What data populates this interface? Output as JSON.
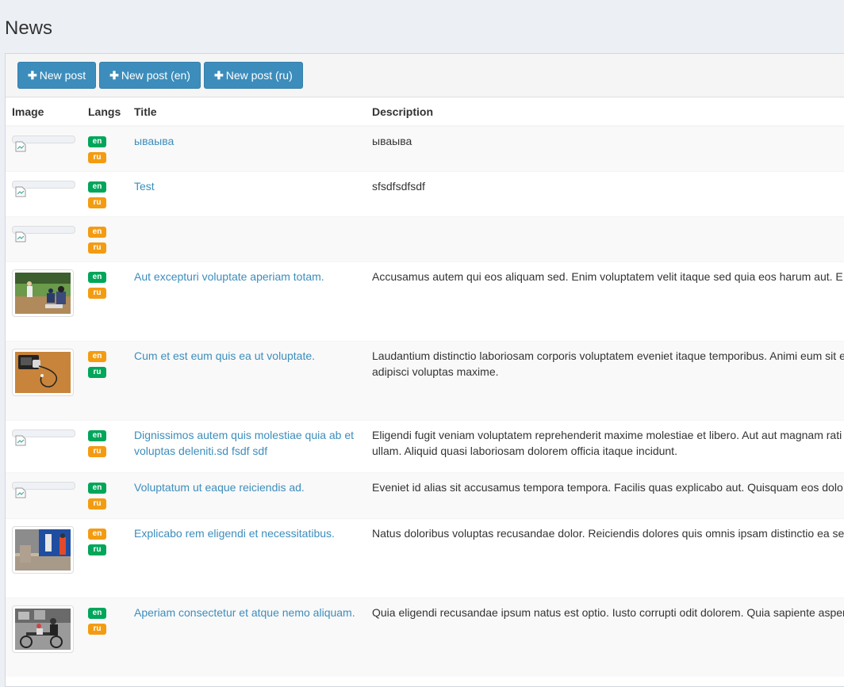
{
  "page_title": "News",
  "toolbar": {
    "buttons": [
      {
        "label": "New post",
        "icon": "plus-icon"
      },
      {
        "label": "New post (en)",
        "icon": "plus-icon"
      },
      {
        "label": "New post (ru)",
        "icon": "plus-icon"
      }
    ]
  },
  "table": {
    "headers": {
      "image": "Image",
      "langs": "Langs",
      "title": "Title",
      "description": "Description"
    },
    "rows": [
      {
        "image": "broken",
        "langs": [
          "en",
          "ru"
        ],
        "title": "ываыва",
        "description": "ываыва"
      },
      {
        "image": "broken",
        "langs": [
          "en",
          "ru"
        ],
        "title": "Test",
        "description": "sfsdfsdfsdf"
      },
      {
        "image": "broken",
        "langs": [
          "en",
          "ru"
        ],
        "title": "",
        "description": ""
      },
      {
        "image": "baseball",
        "langs": [
          "en",
          "ru"
        ],
        "title": "Aut excepturi voluptate aperiam totam.",
        "description": "Accusamus autem qui eos aliquam sed. Enim voluptatem velit itaque sed quia eos harum aut. E"
      },
      {
        "image": "phone",
        "langs": [
          "en",
          "ru"
        ],
        "title": "Cum et est eum quis ea ut voluptate.",
        "description": "Laudantium distinctio laboriosam corporis voluptatem eveniet itaque temporibus. Animi eum sit e Voluptatem minus adipisci voluptas maxime."
      },
      {
        "image": "broken",
        "langs": [
          "en",
          "ru"
        ],
        "title": "Dignissimos autem quis molestiae quia ab et voluptas deleniti.sd fsdf sdf",
        "description": "Eligendi fugit veniam voluptatem reprehenderit maxime molestiae et libero. Aut aut magnam rati alias omnis magnam ullam. Aliquid quasi laboriosam dolorem officia itaque incidunt."
      },
      {
        "image": "broken",
        "langs": [
          "en",
          "ru"
        ],
        "title": "Voluptatum ut eaque reiciendis ad.",
        "description": "Eveniet id alias sit accusamus tempora tempora. Facilis quas explicabo aut. Quisquam eos dolo"
      },
      {
        "image": "street",
        "langs": [
          "en",
          "ru"
        ],
        "title": "Explicabo rem eligendi et necessitatibus.",
        "description": "Natus doloribus voluptas recusandae dolor. Reiciendis dolores quis omnis ipsam distinctio ea se ut ea."
      },
      {
        "image": "bicycle",
        "langs": [
          "en",
          "ru"
        ],
        "title": "Aperiam consectetur et atque nemo aliquam.",
        "description": "Quia eligendi recusandae ipsum natus est optio. Iusto corrupti odit dolorem. Quia sapiente asper"
      }
    ]
  },
  "colors": {
    "primary": "#3c8dbc",
    "en_badge": "#00a65a",
    "ru_badge": "#f39c12",
    "background": "#ecf0f5"
  }
}
